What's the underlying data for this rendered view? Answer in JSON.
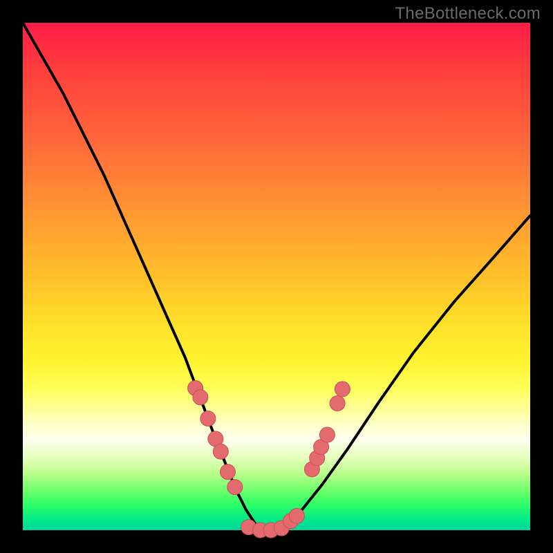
{
  "watermark": "TheBottleneck.com",
  "colors": {
    "frame": "#000000",
    "curve_stroke": "#000000",
    "dot_fill": "#e36a6f",
    "dot_stroke": "#c94f55"
  },
  "chart_data": {
    "type": "line",
    "title": "",
    "xlabel": "",
    "ylabel": "",
    "xlim": [
      0,
      100
    ],
    "ylim": [
      0,
      100
    ],
    "series": [
      {
        "name": "bottleneck-curve",
        "x": [
          0,
          4,
          8,
          12,
          16,
          20,
          24,
          28,
          32,
          35,
          38,
          40,
          42,
          44,
          46,
          48,
          50,
          52,
          55,
          59,
          64,
          70,
          77,
          85,
          93,
          100
        ],
        "y": [
          100,
          93,
          86,
          78,
          70,
          61,
          52,
          43,
          34,
          26,
          18,
          13,
          8,
          4,
          1,
          0,
          0,
          1,
          4,
          9,
          16,
          25,
          35,
          45,
          54,
          62
        ]
      }
    ],
    "dots": [
      {
        "x": 34.0,
        "y": 28.0
      },
      {
        "x": 35.0,
        "y": 26.2
      },
      {
        "x": 36.5,
        "y": 22.0
      },
      {
        "x": 38.0,
        "y": 18.0
      },
      {
        "x": 39.0,
        "y": 15.5
      },
      {
        "x": 40.4,
        "y": 11.5
      },
      {
        "x": 41.8,
        "y": 8.5
      },
      {
        "x": 44.5,
        "y": 0.6
      },
      {
        "x": 46.8,
        "y": 0.0
      },
      {
        "x": 48.9,
        "y": 0.0
      },
      {
        "x": 51.0,
        "y": 0.4
      },
      {
        "x": 52.8,
        "y": 1.8
      },
      {
        "x": 54.0,
        "y": 2.8
      },
      {
        "x": 57.0,
        "y": 12.0
      },
      {
        "x": 58.0,
        "y": 14.2
      },
      {
        "x": 58.8,
        "y": 16.4
      },
      {
        "x": 60.0,
        "y": 18.8
      },
      {
        "x": 62.0,
        "y": 25.0
      },
      {
        "x": 63.0,
        "y": 27.8
      }
    ],
    "annotations": []
  }
}
